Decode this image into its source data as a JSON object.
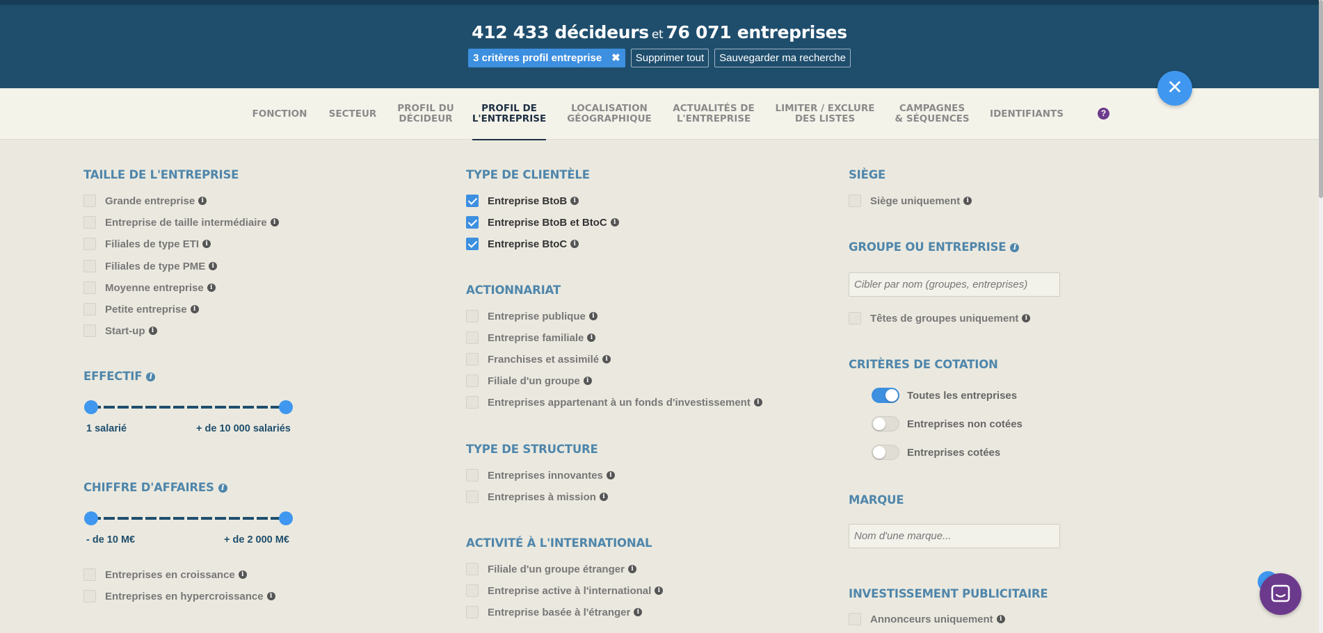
{
  "header": {
    "decideurs_count": "412 433 décideurs",
    "connector": "et",
    "entreprises_count": "76 071 entreprises",
    "active_chip": "3 critères profil entreprise",
    "clear_all": "Supprimer tout",
    "save_search": "Sauvegarder ma recherche"
  },
  "tabs": [
    "FONCTION",
    "SECTEUR",
    "PROFIL DU\nDÉCIDEUR",
    "PROFIL DE\nL'ENTREPRISE",
    "LOCALISATION\nGÉOGRAPHIQUE",
    "ACTUALITÉS DE\nL'ENTREPRISE",
    "LIMITER / EXCLURE\nDES LISTES",
    "CAMPAGNES\n& SÉQUENCES",
    "IDENTIFIANTS"
  ],
  "active_tab": "PROFIL DE\nL'ENTREPRISE",
  "help_icon": "?",
  "taille": {
    "title": "TAILLE DE L'ENTREPRISE",
    "items": [
      "Grande entreprise",
      "Entreprise de taille intermédiaire",
      "Filiales de type ETI",
      "Filiales de type PME",
      "Moyenne entreprise",
      "Petite entreprise",
      "Start-up"
    ]
  },
  "effectif": {
    "title": "EFFECTIF",
    "min_label": "1 salarié",
    "max_label": "+ de 10 000 salariés"
  },
  "ca": {
    "title": "CHIFFRE D'AFFAIRES",
    "min_label": "- de 10 M€",
    "max_label": "+ de 2 000 M€",
    "items": [
      "Entreprises en croissance",
      "Entreprises en hypercroissance"
    ]
  },
  "clientele": {
    "title": "TYPE DE CLIENTÈLE",
    "items": [
      "Entreprise BtoB",
      "Entreprise BtoB et BtoC",
      "Entreprise BtoC"
    ]
  },
  "actionnariat": {
    "title": "ACTIONNARIAT",
    "items": [
      "Entreprise publique",
      "Entreprise familiale",
      "Franchises et assimilé",
      "Filiale d'un groupe",
      "Entreprises appartenant à un fonds d'investissement"
    ]
  },
  "structure": {
    "title": "TYPE DE STRUCTURE",
    "items": [
      "Entreprises innovantes",
      "Entreprises à mission"
    ]
  },
  "international": {
    "title": "ACTIVITÉ À L'INTERNATIONAL",
    "items": [
      "Filiale d'un groupe étranger",
      "Entreprise active à l'international",
      "Entreprise basée à l'étranger"
    ]
  },
  "siege": {
    "title": "SIÈGE",
    "item": "Siège uniquement"
  },
  "groupe": {
    "title": "GROUPE OU ENTREPRISE",
    "placeholder": "Cibler par nom (groupes, entreprises)",
    "item": "Têtes de groupes uniquement"
  },
  "cotation": {
    "title": "CRITÈRES DE COTATION",
    "items": [
      "Toutes les entreprises",
      "Entreprises non cotées",
      "Entreprises cotées"
    ],
    "selected": "Toutes les entreprises"
  },
  "marque": {
    "title": "MARQUE",
    "placeholder": "Nom d'une marque..."
  },
  "invest": {
    "title": "INVESTISSEMENT PUBLICITAIRE",
    "item": "Annonceurs uniquement"
  },
  "colors": {
    "header_bg": "#1f4e6d",
    "accent": "#3d8fe0",
    "section_title": "#4f86ab",
    "chat": "#6c3a8c"
  }
}
